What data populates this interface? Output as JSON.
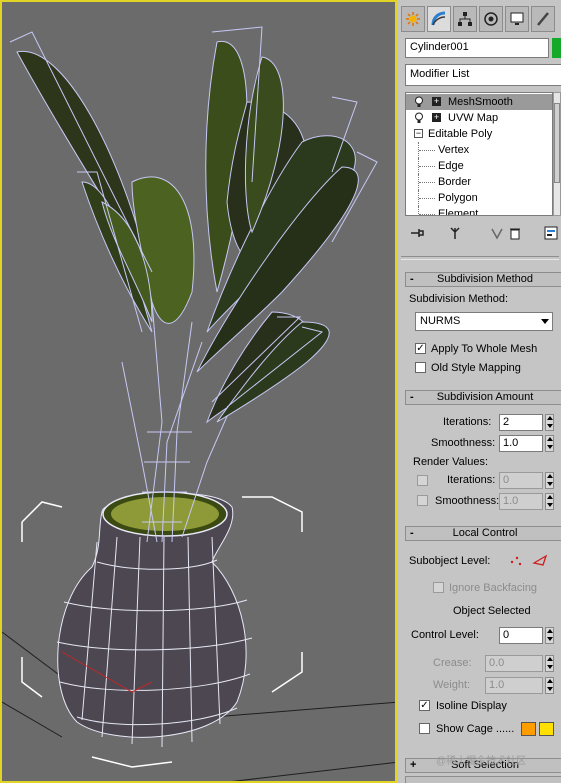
{
  "viewport": {
    "name": "3d-viewport",
    "colors": {
      "background": "#6b6b6b",
      "active_border": "#e2d327",
      "wire": "#c5c6f2",
      "leaf": "#2f3a1b",
      "vase": "#4f4a52"
    }
  },
  "command_panel": {
    "tabs": [
      {
        "icon": "create-icon",
        "active": false
      },
      {
        "icon": "modify-icon",
        "active": true
      },
      {
        "icon": "hierarchy-icon",
        "active": false
      },
      {
        "icon": "motion-icon",
        "active": false
      },
      {
        "icon": "display-icon",
        "active": false
      },
      {
        "icon": "utilities-icon",
        "active": false
      }
    ],
    "object_name": "Cylinder001",
    "object_color": "#15a92a",
    "modifier_list_label": "Modifier List",
    "stack": [
      {
        "label": "MeshSmooth",
        "selected": true
      },
      {
        "label": "UVW Map",
        "selected": false
      },
      {
        "label": "Editable Poly",
        "selected": false
      },
      {
        "label": "Vertex",
        "selected": false
      },
      {
        "label": "Edge",
        "selected": false
      },
      {
        "label": "Border",
        "selected": false
      },
      {
        "label": "Polygon",
        "selected": false
      },
      {
        "label": "Element",
        "selected": false
      }
    ],
    "stack_toolbar": [
      "pin-stack-icon",
      "show-end-result-icon",
      "make-unique-icon",
      "remove-modifier-icon",
      "configure-modifier-sets-icon"
    ]
  },
  "subdivision_method": {
    "title": "Subdivision Method",
    "method_label": "Subdivision Method:",
    "method_value": "NURMS",
    "apply_whole_mesh": {
      "label": "Apply To Whole Mesh",
      "checked": true
    },
    "old_style_mapping": {
      "label": "Old Style Mapping",
      "checked": false
    }
  },
  "subdivision_amount": {
    "title": "Subdivision Amount",
    "iterations_label": "Iterations:",
    "iterations_value": "2",
    "smoothness_label": "Smoothness:",
    "smoothness_value": "1.0",
    "render_values_label": "Render Values:",
    "render_iterations_label": "Iterations:",
    "render_iterations_value": "0",
    "render_smoothness_label": "Smoothness:",
    "render_smoothness_value": "1.0"
  },
  "local_control": {
    "title": "Local Control",
    "subobject_label": "Subobject Level:",
    "ignore_backfacing": "Ignore Backfacing",
    "object_selected": "Object Selected",
    "control_level_label": "Control Level:",
    "control_level_value": "0",
    "crease_label": "Crease:",
    "crease_value": "0.0",
    "weight_label": "Weight:",
    "weight_value": "1.0",
    "isoline_display": {
      "label": "Isoline Display",
      "checked": true
    },
    "show_cage": {
      "label": "Show Cage ......",
      "checked": false
    },
    "cage_colors": [
      "#ff9c00",
      "#ffe000"
    ]
  },
  "soft_selection": {
    "title": "Soft Selection"
  },
  "watermark": "@稀土掘金技术社区"
}
